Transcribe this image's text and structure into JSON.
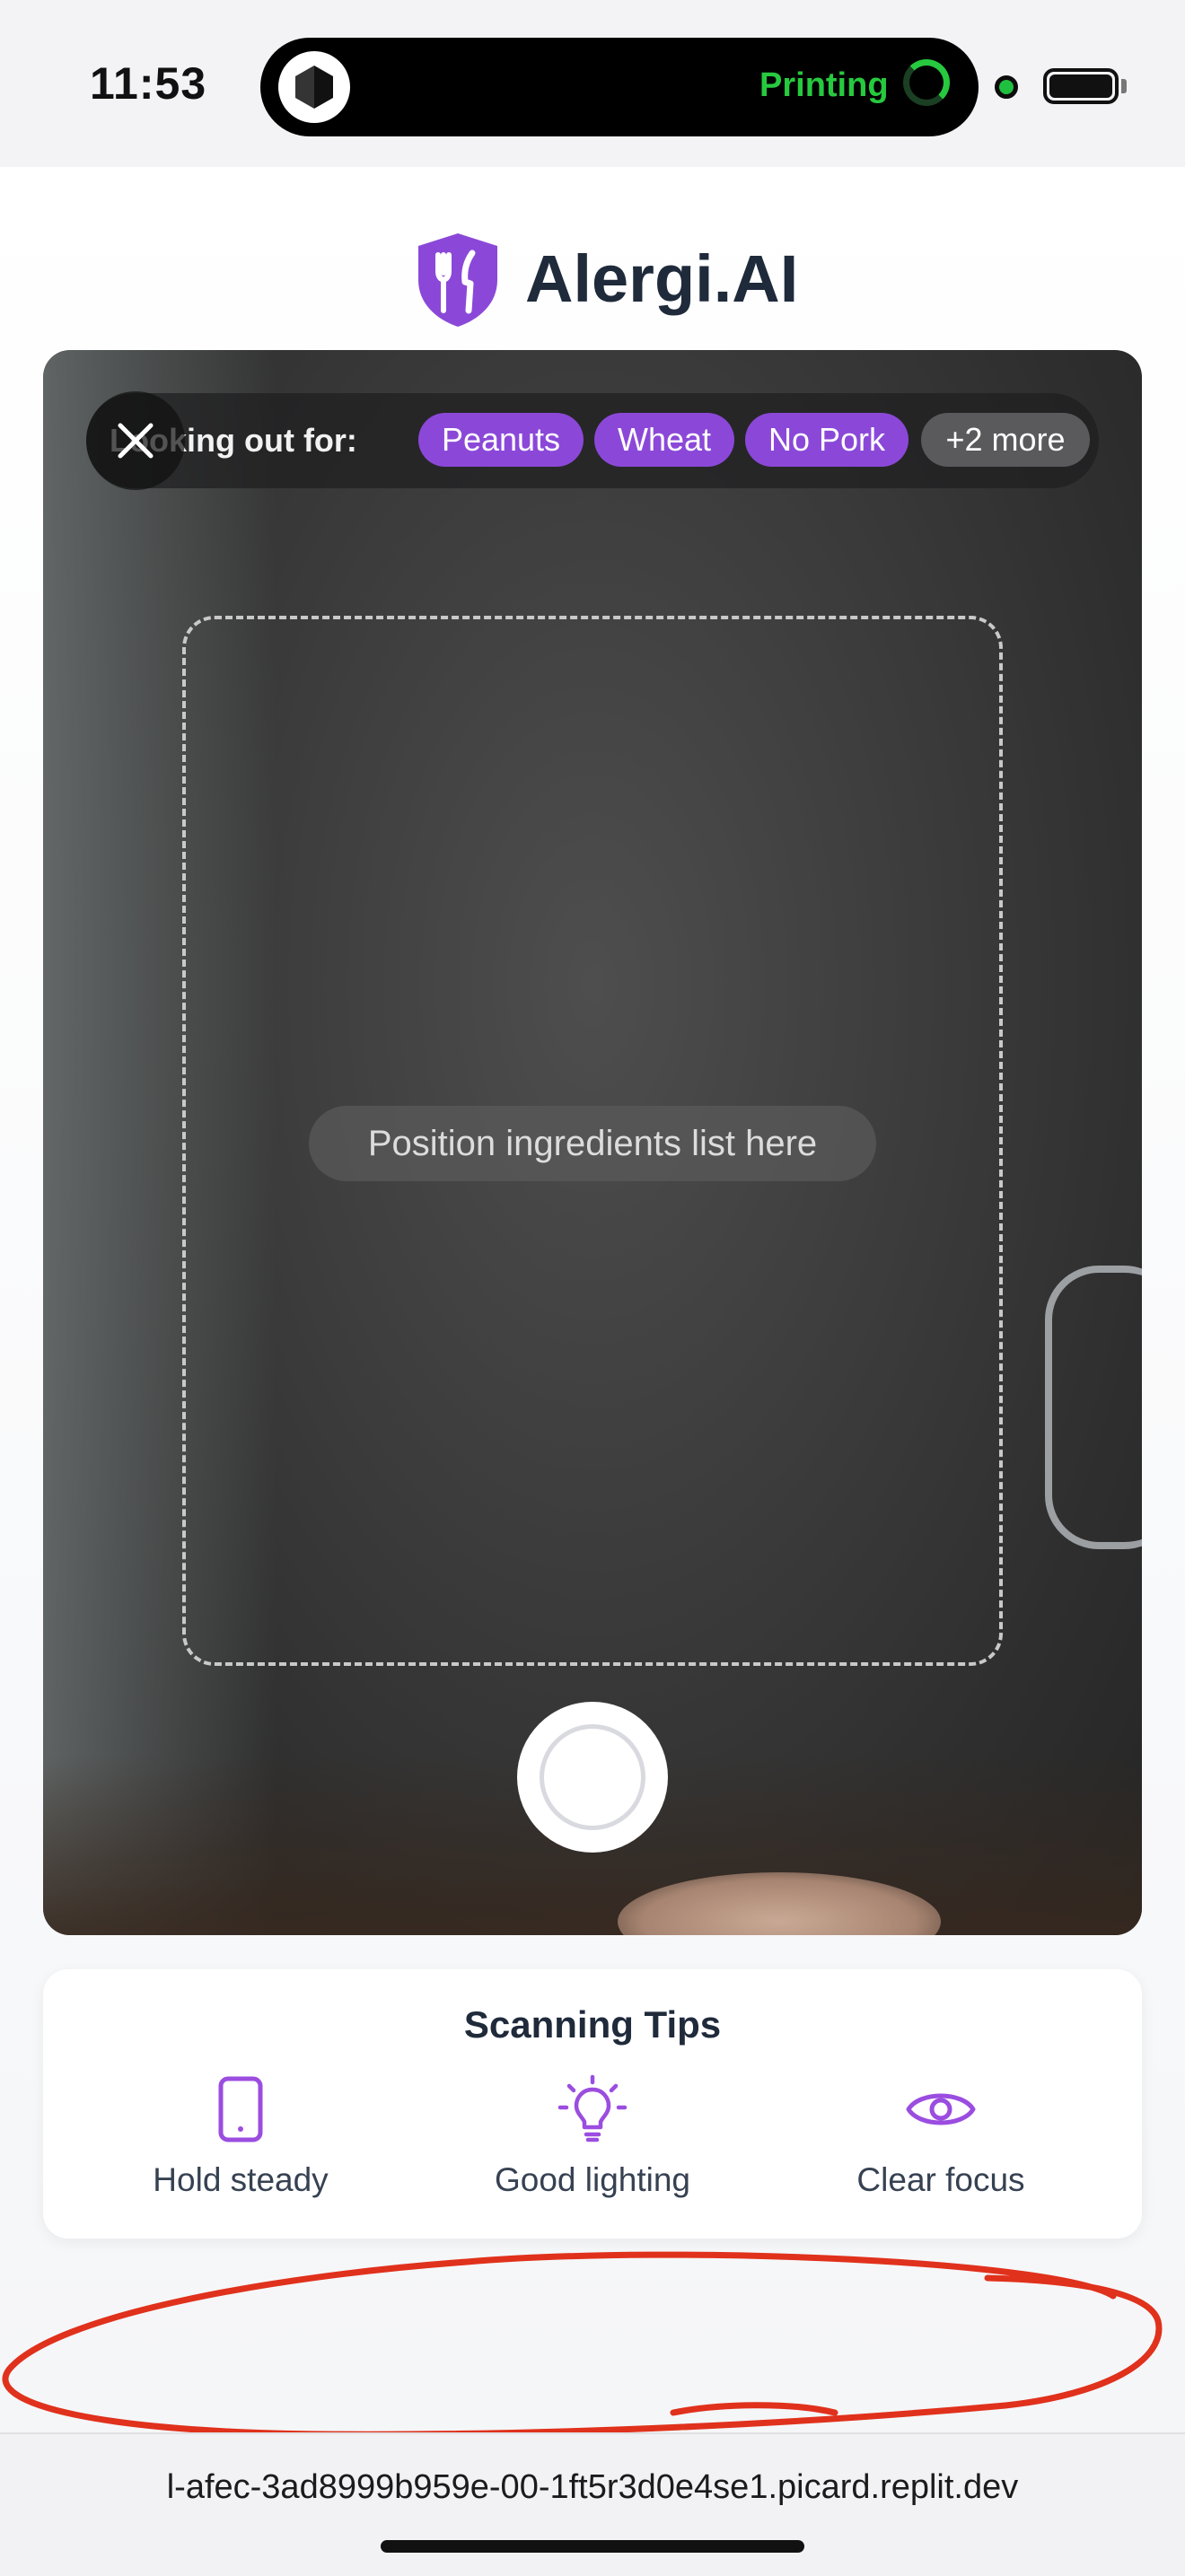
{
  "status_bar": {
    "time": "11:53",
    "live_activity_text": "Printing",
    "accent_color": "#27c93f"
  },
  "header": {
    "brand": "Alergi.AI",
    "logo_icon": "shield-fork-knife-icon",
    "brand_color": "#8b48d8"
  },
  "camera": {
    "looking_out_label": "Looking out for:",
    "allergen_chips": [
      "Peanuts",
      "Wheat",
      "No Pork"
    ],
    "more_chip": "+2 more",
    "frame_hint": "Position ingredients list here",
    "close_icon": "close-icon",
    "shutter_icon": "shutter-button"
  },
  "tips": {
    "title": "Scanning Tips",
    "items": [
      {
        "label": "Hold steady",
        "icon": "phone-icon"
      },
      {
        "label": "Good lighting",
        "icon": "lightbulb-icon"
      },
      {
        "label": "Clear focus",
        "icon": "eye-icon"
      }
    ],
    "icon_color": "#9b4de0"
  },
  "browser": {
    "url": "l-afec-3ad8999b959e-00-1ft5r3d0e4se1.picard.replit.dev"
  }
}
